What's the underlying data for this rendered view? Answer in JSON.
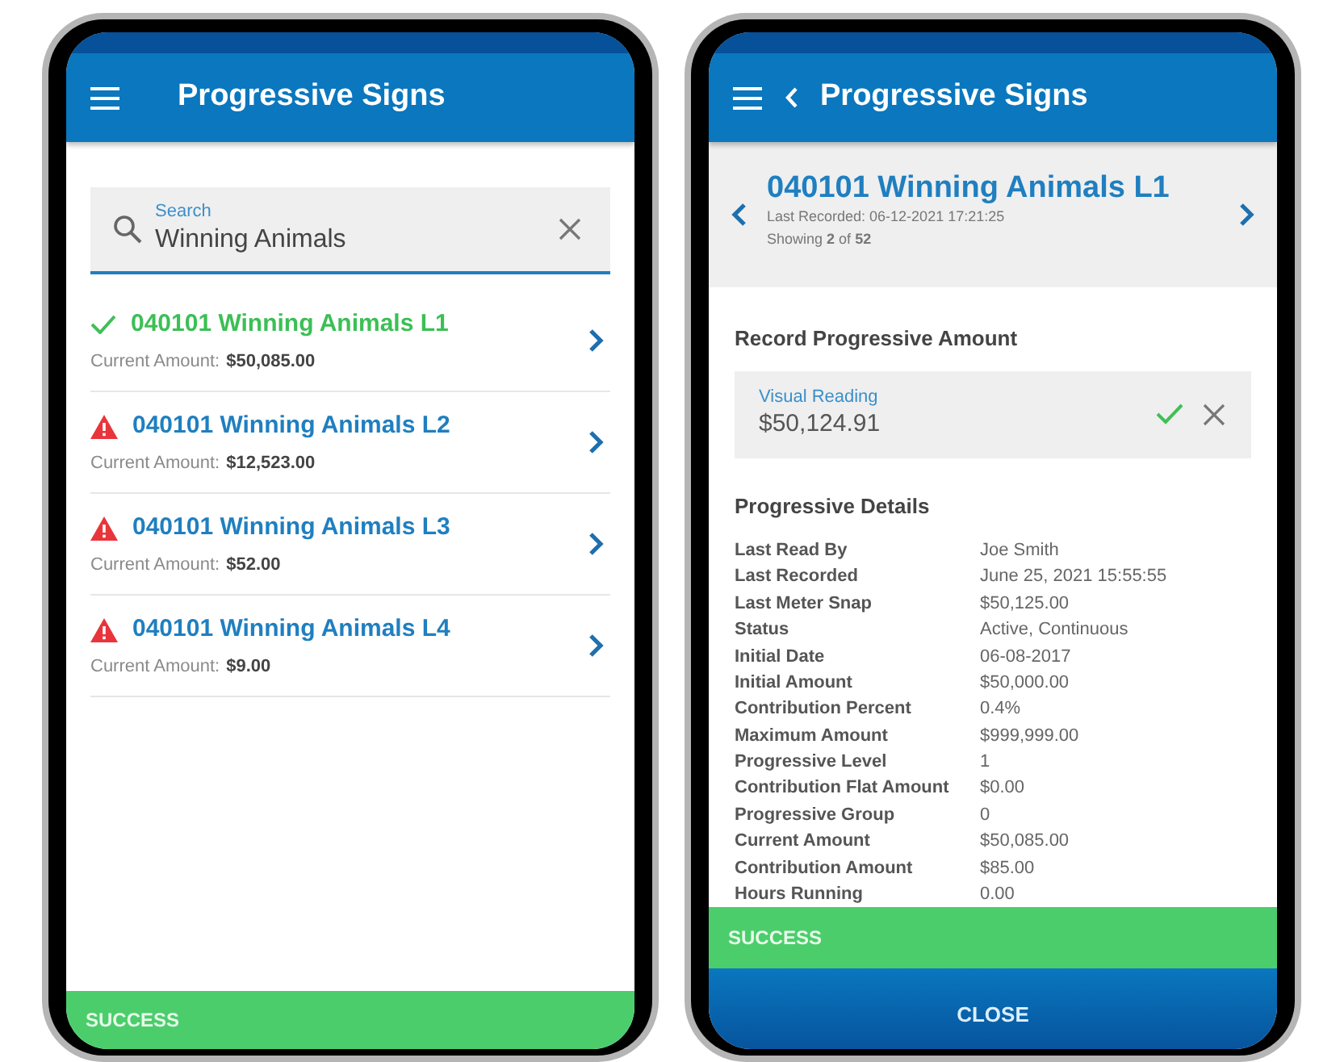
{
  "list_screen": {
    "header": {
      "title": "Progressive Signs"
    },
    "search": {
      "label": "Search",
      "value": "Winning Animals"
    },
    "items": [
      {
        "title": "040101 Winning Animals L1",
        "kind": "recorded",
        "amount_label": "Current Amount:",
        "amount": "$50,085.00"
      },
      {
        "title": "040101 Winning Animals L2",
        "kind": "warning",
        "amount_label": "Current Amount:",
        "amount": "$12,523.00"
      },
      {
        "title": "040101 Winning Animals L3",
        "kind": "warning",
        "amount_label": "Current Amount:",
        "amount": "$52.00"
      },
      {
        "title": "040101 Winning Animals L4",
        "kind": "warning",
        "amount_label": "Current Amount:",
        "amount": "$9.00"
      }
    ],
    "banner": "SUCCESS"
  },
  "detail_screen": {
    "header": {
      "title": "Progressive Signs"
    },
    "sign": {
      "title": "040101 Winning Animals L1",
      "last_recorded": "Last Recorded: 06-12-2021 17:21:25",
      "showing": "Showing **2** of **52**"
    },
    "record_heading": "Record Progressive Amount",
    "reading": {
      "label": "Visual Reading",
      "value": "$50,124.91"
    },
    "details_heading": "Progressive Details",
    "details": [
      {
        "label": "Last Read By",
        "value": "Joe Smith"
      },
      {
        "label": "Last Recorded",
        "value": "June 25, 2021 15:55:55"
      },
      {
        "label": "Last Meter Snap",
        "value": "$50,125.00"
      },
      {
        "label": "Status",
        "value": "Active, Continuous"
      },
      {
        "label": "Initial Date",
        "value": "06-08-2017"
      },
      {
        "label": "Initial Amount",
        "value": "$50,000.00"
      },
      {
        "label": "Contribution Percent",
        "value": "0.4%"
      },
      {
        "label": "Maximum Amount",
        "value": "$999,999.00"
      },
      {
        "label": "Progressive Level",
        "value": "1"
      },
      {
        "label": "Contribution Flat Amount",
        "value": "$0.00"
      },
      {
        "label": "Progressive Group",
        "value": "0"
      },
      {
        "label": "Current Amount",
        "value": "$50,085.00"
      },
      {
        "label": "Contribution Amount",
        "value": "$85.00"
      },
      {
        "label": "Hours Running",
        "value": "0.00"
      }
    ],
    "banner": "SUCCESS",
    "close_button": "CLOSE"
  }
}
